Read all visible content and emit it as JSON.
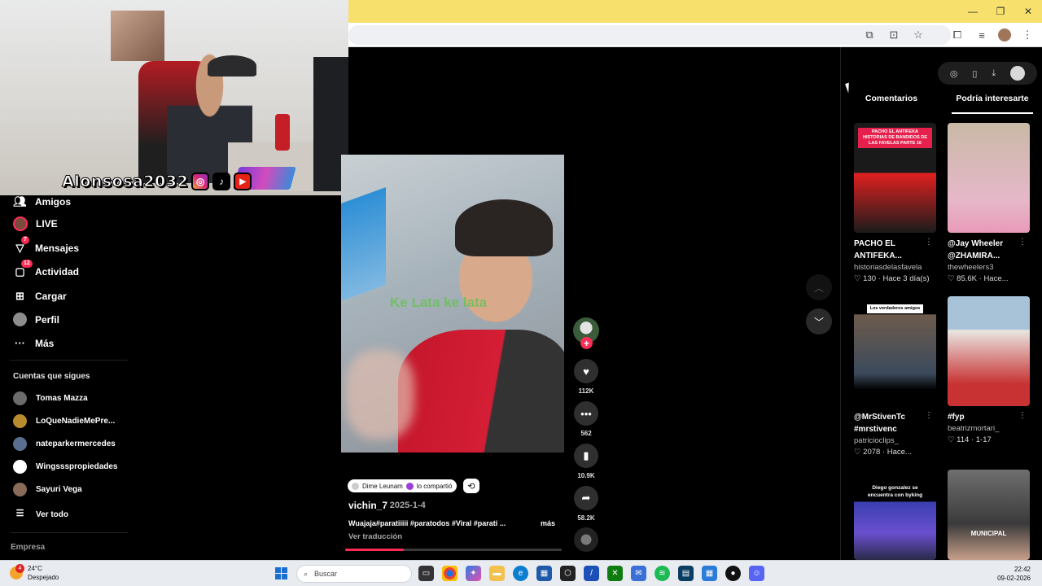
{
  "sidebar": {
    "items": [
      {
        "label": "Amigos",
        "icon": "friends-icon"
      },
      {
        "label": "LIVE",
        "icon": "live-icon"
      },
      {
        "label": "Mensajes",
        "icon": "messages-icon",
        "badge": "7"
      },
      {
        "label": "Actividad",
        "icon": "activity-icon",
        "badge": "12"
      },
      {
        "label": "Cargar",
        "icon": "upload-icon"
      },
      {
        "label": "Perfil",
        "icon": "profile-icon"
      },
      {
        "label": "Más",
        "icon": "more-icon"
      }
    ],
    "following_title": "Cuentas que sigues",
    "following": [
      {
        "name": "Tomas Mazza",
        "color": "#6b6b6b"
      },
      {
        "name": "LoQueNadieMePre...",
        "color": "#b88b2e"
      },
      {
        "name": "nateparkermercedes",
        "color": "#5a6f8f"
      },
      {
        "name": "Wingssspropiedades",
        "color": "#ffffff"
      },
      {
        "name": "Sayuri Vega",
        "color": "#8a6b5a"
      }
    ],
    "see_all": "Ver todo",
    "footer": "Empresa"
  },
  "webcam": {
    "handle": "Alonsosa2032"
  },
  "video": {
    "caption_overlay": "Ke Lata ke lata",
    "shared_by": "Dime Leunam",
    "shared_text": "lo compartió",
    "author": "vichin_7",
    "date": "· 2025-1-4",
    "description": "Wuajaja#paratiiiii #paratodos #Viral #parati ...",
    "more": "más",
    "translate": "Ver traducción",
    "progress": 0.27
  },
  "actions": {
    "likes": "112K",
    "comments": "562",
    "saves": "10.9K",
    "shares": "58.2K"
  },
  "right_panel": {
    "tabs": [
      "Comentarios",
      "Podría interesarte"
    ],
    "active_tab": 1,
    "cards": [
      {
        "title": "PACHO EL ANTIFEKA...",
        "user": "historiasdelasfavela",
        "likes": "130",
        "time": "Hace 3 día(s)",
        "thumb_label": "PACHO EL ANTIFEKA HISTORIAS DE BANDIDOS DE LAS FAVELAS PARTE 16"
      },
      {
        "title": "@Jay Wheeler @ZHAMIRA...",
        "user": "thewheelers3",
        "likes": "85.6K",
        "time": "Hace..."
      },
      {
        "title": "@MrStivenTc #mrstivenc",
        "user": "patricioclips_",
        "likes": "2078",
        "time": "Hace...",
        "thumb_label": "Los verdaderos amigos"
      },
      {
        "title": "#fyp",
        "user": "beatrizmortari_",
        "likes": "114",
        "time": "1-17"
      },
      {
        "title": "",
        "user": "",
        "likes": "",
        "time": "",
        "thumb_label": "Diego gonzalez se encuentra con byking"
      },
      {
        "title": "",
        "user": "",
        "likes": "",
        "time": "",
        "thumb_label": "MUNICIPAL"
      }
    ]
  },
  "taskbar": {
    "temperature": "24°C",
    "weather": "Despejado",
    "weather_badge": "4",
    "search_placeholder": "Buscar",
    "time": "22:42",
    "date": "09-02-2026"
  },
  "colors": {
    "accent": "#fe2c55",
    "titlebar": "#f7e06b",
    "background": "#000000"
  }
}
